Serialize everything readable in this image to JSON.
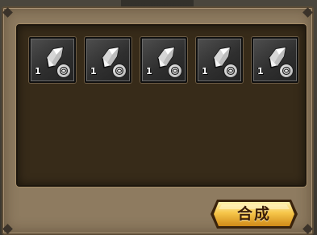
{
  "slots": [
    {
      "item": "crystal-shard",
      "count": "1",
      "badge": "rune-badge"
    },
    {
      "item": "crystal-shard",
      "count": "1",
      "badge": "rune-badge"
    },
    {
      "item": "crystal-shard",
      "count": "1",
      "badge": "rune-badge"
    },
    {
      "item": "crystal-shard",
      "count": "1",
      "badge": "rune-badge"
    },
    {
      "item": "crystal-shard",
      "count": "1",
      "badge": "rune-badge"
    }
  ],
  "craft_button": {
    "label": "合成"
  },
  "colors": {
    "panel": "#8e7b60",
    "inner": "#372b19",
    "button_gold": "#f0b83a",
    "button_text": "#3b1e08"
  }
}
